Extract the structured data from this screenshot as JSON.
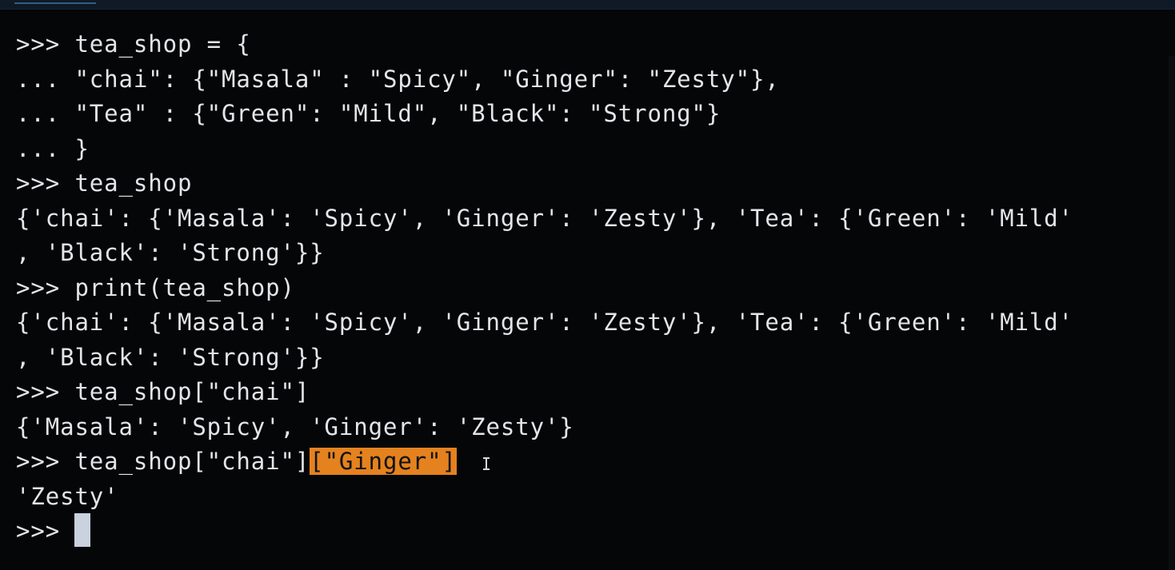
{
  "terminal": {
    "lines": [
      {
        "text": ">>> tea_shop = {"
      },
      {
        "text": "... \"chai\": {\"Masala\" : \"Spicy\", \"Ginger\": \"Zesty\"},"
      },
      {
        "text": "... \"Tea\" : {\"Green\": \"Mild\", \"Black\": \"Strong\"}"
      },
      {
        "text": "... }"
      },
      {
        "text": ">>> tea_shop"
      },
      {
        "text": "{'chai': {'Masala': 'Spicy', 'Ginger': 'Zesty'}, 'Tea': {'Green': 'Mild'"
      },
      {
        "text": ", 'Black': 'Strong'}}"
      },
      {
        "text": ">>> print(tea_shop)"
      },
      {
        "text": "{'chai': {'Masala': 'Spicy', 'Ginger': 'Zesty'}, 'Tea': {'Green': 'Mild'"
      },
      {
        "text": ", 'Black': 'Strong'}}"
      },
      {
        "text": ">>> tea_shop[\"chai\"]"
      },
      {
        "text": "{'Masala': 'Spicy', 'Ginger': 'Zesty'}"
      },
      {
        "prefix": ">>> tea_shop[\"chai\"]",
        "highlight": "[\"Ginger\"]"
      },
      {
        "text": "'Zesty'"
      },
      {
        "prompt": ">>> "
      }
    ]
  },
  "colors": {
    "background": "#050608",
    "text": "#e3e5e8",
    "selection": "#e4821f",
    "cursor": "#c9d2de"
  }
}
